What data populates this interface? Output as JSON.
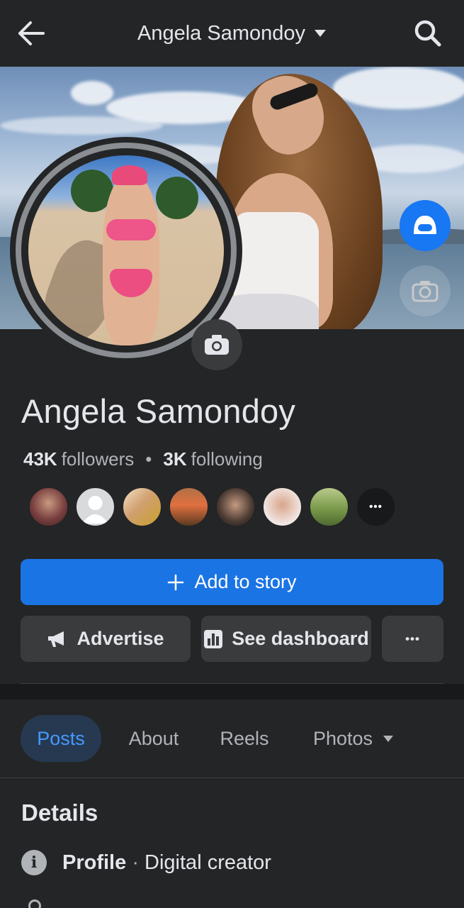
{
  "header": {
    "title": "Angela Samondoy",
    "back_icon": "arrow-left-icon",
    "dropdown_icon": "caret-down-icon",
    "search_icon": "search-icon"
  },
  "profile": {
    "name": "Angela Samondoy",
    "followers_count": "43K",
    "followers_label": "followers",
    "following_count": "3K",
    "following_label": "following",
    "separator": "•"
  },
  "friends": [
    {
      "name": "friend-1",
      "color": "#6a3a3a"
    },
    {
      "name": "friend-2",
      "color": "#d9dadb"
    },
    {
      "name": "friend-3",
      "color": "#c7a35a"
    },
    {
      "name": "friend-4",
      "color": "#8a5a3a"
    },
    {
      "name": "friend-5",
      "color": "#3a3530"
    },
    {
      "name": "friend-6",
      "color": "#e8d6cf"
    },
    {
      "name": "friend-7",
      "color": "#6f8f4a"
    }
  ],
  "friends_more_label": "•••",
  "actions": {
    "add_story_label": "Add to story",
    "add_story_plus": "+",
    "advertise_label": "Advertise",
    "dashboard_label": "See dashboard",
    "more_label": "•••"
  },
  "tabs": [
    {
      "label": "Posts",
      "active": true
    },
    {
      "label": "About",
      "active": false
    },
    {
      "label": "Reels",
      "active": false
    },
    {
      "label": "Photos",
      "active": false
    }
  ],
  "details": {
    "heading": "Details",
    "profile_label": "Profile",
    "profile_sep": "·",
    "profile_value": "Digital creator",
    "info_icon_glyph": "i"
  },
  "colors": {
    "accent": "#1b74e4",
    "background": "#242526",
    "active_tab_bg": "#263951",
    "active_tab_text": "#4599ff"
  }
}
